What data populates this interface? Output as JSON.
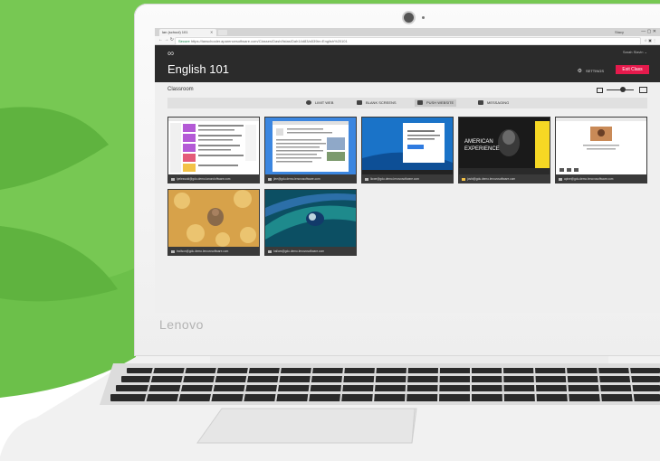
{
  "colors": {
    "background_green": "#6cc04a",
    "header_dark": "#2b2b2b",
    "exit_button": "#e51a4c",
    "caption_bar": "#3a3a3a"
  },
  "laptop": {
    "brand": "Lenovo"
  },
  "browser": {
    "tab_title": "lan (school) 101",
    "url_secure_label": "Secure",
    "url": "https://lanschooler.aparencesoftware.com/Classes/Dash/Iistas/Dah14d83/a539ie=English%20101",
    "profile": "Stacy"
  },
  "app": {
    "logo_glyph": "∞",
    "user": "Sarah Slavin ⌄",
    "class_title": "English 101",
    "settings_label": "SETTINGS",
    "exit_label": "Exit Class",
    "section_label": "Classroom"
  },
  "toolbar": {
    "items": [
      {
        "label": "LIMIT WEB",
        "icon": "limit-web-icon"
      },
      {
        "label": "BLANK SCREENS",
        "icon": "blank-screen-icon"
      },
      {
        "label": "PUSH WEBSITE",
        "icon": "push-website-icon"
      },
      {
        "label": "MESSAGING",
        "icon": "messaging-icon"
      }
    ]
  },
  "students": [
    {
      "email": "lpelessoid@gdu.demo.lanoroloftware.com",
      "icon": "chrome-icon"
    },
    {
      "email": "jlee@gdu.demo.lenovosoftware.com",
      "icon": "chrome-icon"
    },
    {
      "email": "llowe@gdu.demo.lenovosoftware.com",
      "icon": "windows-icon"
    },
    {
      "email": "joshi@gdu.demo.lenovosoftware.com",
      "icon": "folder-icon"
    },
    {
      "email": "apine@gdu.demo.lenovosoftware.com",
      "icon": "chrome-icon"
    },
    {
      "email": "bwilson@gdu.demo.lenovosoftware.com",
      "icon": "windows-icon"
    },
    {
      "email": "hallam@gdu.demo.lenovosoftware.com",
      "icon": "chrome-icon"
    }
  ]
}
